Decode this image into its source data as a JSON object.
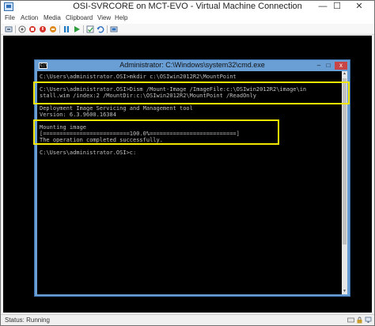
{
  "window": {
    "title": "OSI-SVRCORE on MCT-EVO - Virtual Machine Connection",
    "minimize": "—",
    "maximize": "☐",
    "close": "✕"
  },
  "menu": [
    "File",
    "Action",
    "Media",
    "Clipboard",
    "View",
    "Help"
  ],
  "console": {
    "title": "Administrator: C:\\Windows\\system32\\cmd.exe",
    "icon_text": "C:\\",
    "minimize": "–",
    "maximize": "□",
    "close": "x",
    "lines": [
      "C:\\Users\\administrator.OSI>mkdir c:\\OSIwin2012R2\\MountPoint",
      "",
      "C:\\Users\\administrator.OSI>Dism /Mount-Image /ImageFile:c:\\OSIwin2012R2\\image\\in",
      "stall.wim /index:2 /MountDir:c:\\OSIwin2012R2\\MountPoint /ReadOnly",
      "",
      "Deployment Image Servicing and Management tool",
      "Version: 6.3.9600.16384",
      "",
      "Mounting image",
      "[==========================100.0%==========================]",
      "The operation completed successfully.",
      "",
      "C:\\Users\\administrator.OSI>c:"
    ]
  },
  "status": {
    "text": "Status: Running"
  },
  "colors": {
    "highlight": "#f2e500",
    "console_text": "#c0c0c0",
    "console_frame": "#6a9fd6"
  }
}
